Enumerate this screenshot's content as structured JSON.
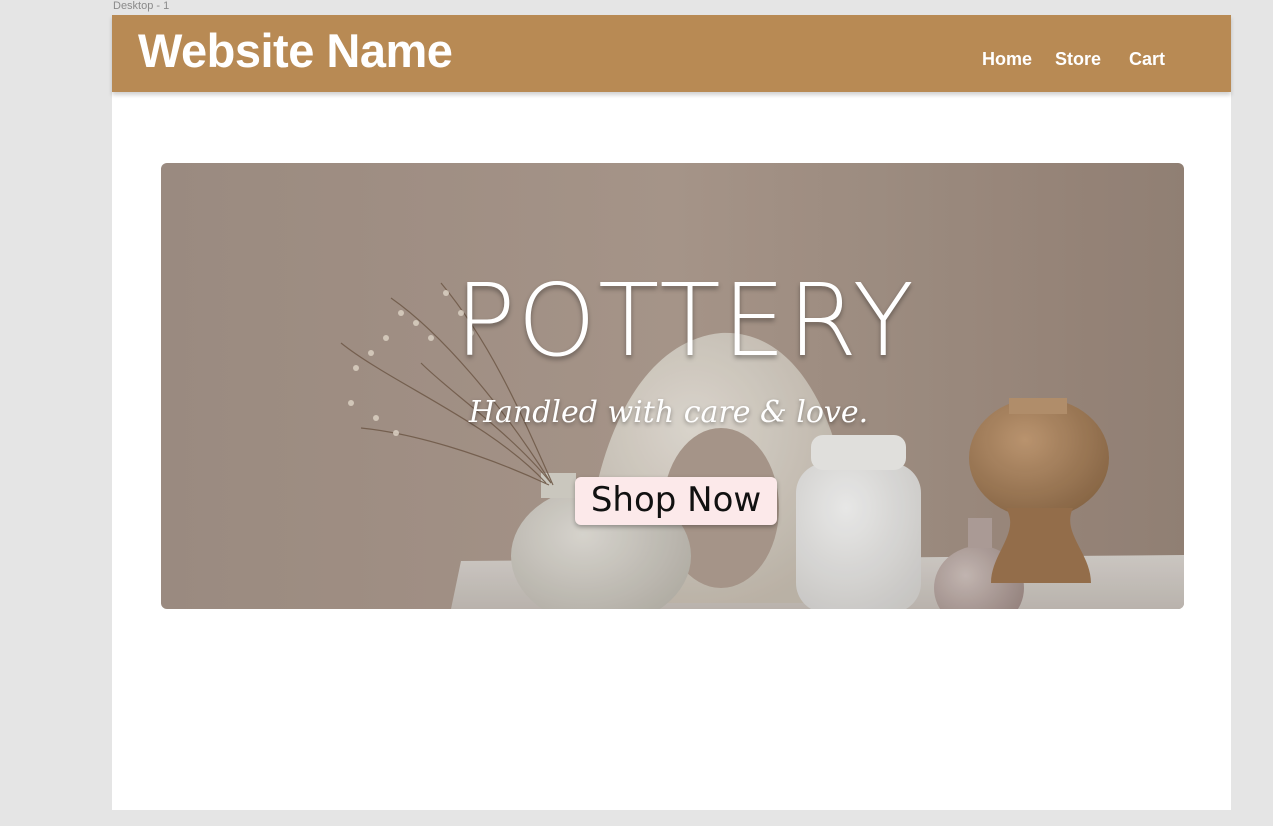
{
  "frame": {
    "label": "Desktop - 1"
  },
  "header": {
    "site_name": "Website Name",
    "nav": [
      {
        "label": "Home"
      },
      {
        "label": "Store"
      },
      {
        "label": "Cart"
      }
    ]
  },
  "hero": {
    "title": "POTTERY",
    "subtitle": "Handled with care & love.",
    "cta_label": "Shop Now"
  },
  "colors": {
    "header_bg": "#b88a54",
    "button_bg": "#fce9ea",
    "page_bg": "#e5e5e5",
    "frame_bg": "#ffffff"
  }
}
